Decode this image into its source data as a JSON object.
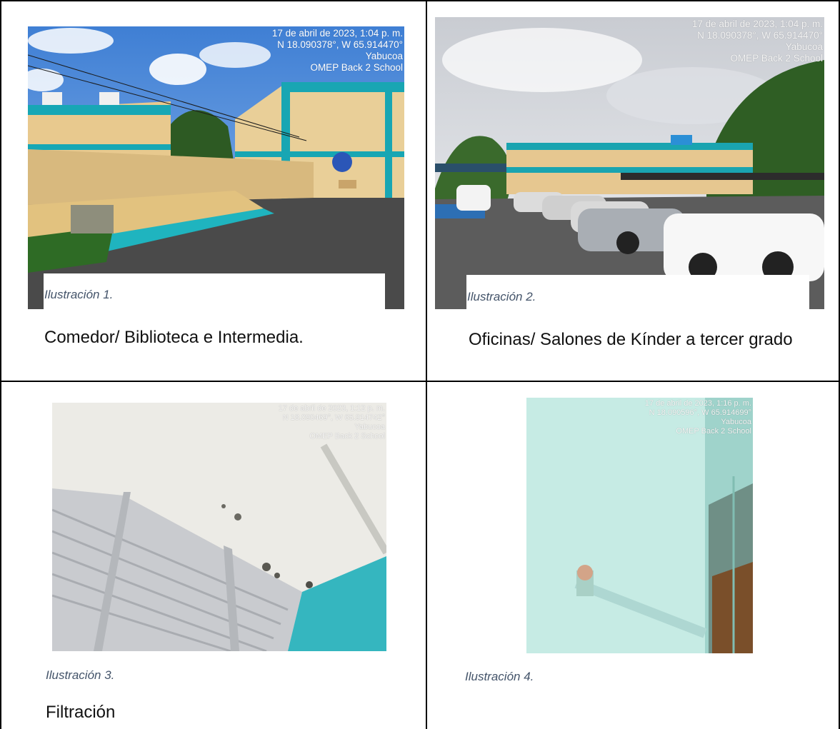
{
  "cells": [
    {
      "stamp": [
        "17 de abril de 2023, 1:04 p. m.",
        "N 18.090378°, W 65.914470°",
        "Yabucoa",
        "OMEP Back 2 School"
      ],
      "caption": "Ilustración 1.",
      "text": "Comedor/ Biblioteca e Intermedia."
    },
    {
      "stamp": [
        "17 de abril de 2023, 1:04 p. m.",
        "N 18.090378°, W 65.914470°",
        "Yabucoa",
        "OMEP Back 2 School"
      ],
      "caption": "Ilustración 2.",
      "text": "Oficinas/ Salones de Kínder a tercer grado"
    },
    {
      "stamp": [
        "17 de abril de 2023, 1:12 p. m.",
        "N 18.090469°, W 65.914742°",
        "Yabucoa",
        "OMEP Back 2 School"
      ],
      "caption": "Ilustración 3.",
      "text": "Filtración"
    },
    {
      "stamp": [
        "17 de abril de 2023, 1:16 p. m.",
        "N 18.090596°, W 65.914699°",
        "Yabucoa",
        "OMEP Back 2 School"
      ],
      "caption": "Ilustración 4.",
      "text": ""
    }
  ]
}
